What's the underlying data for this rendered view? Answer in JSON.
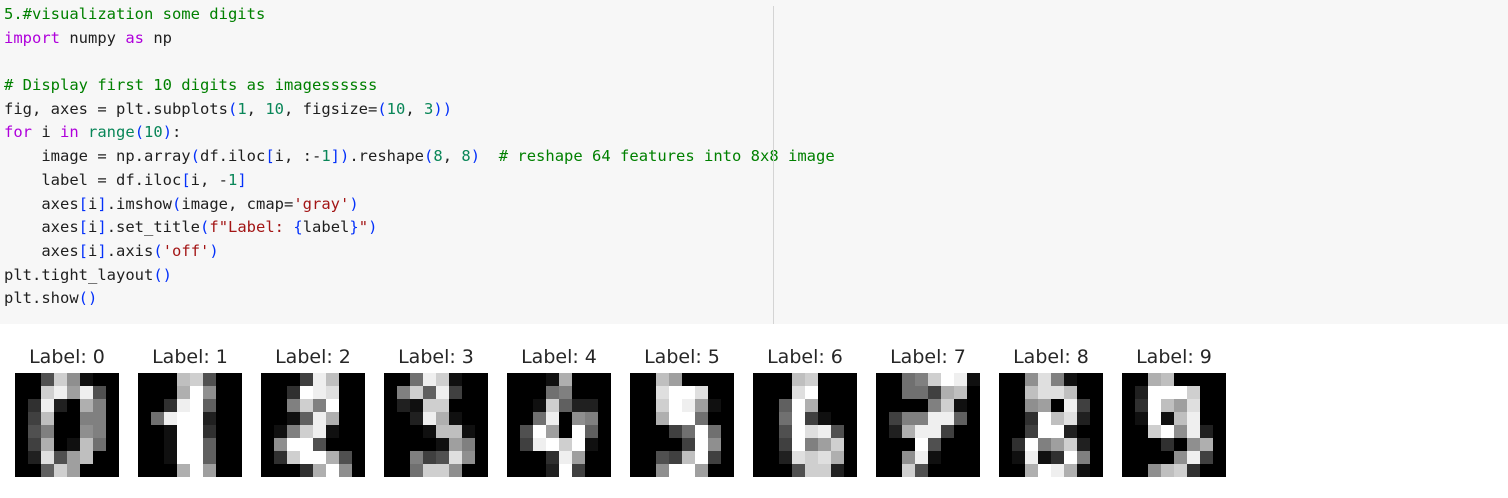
{
  "code_cell": {
    "lines": [
      [
        {
          "t": "5.#visualization some digits",
          "c": "comment"
        }
      ],
      [
        {
          "t": "import",
          "c": "keyword"
        },
        {
          "t": " numpy ",
          "c": "default"
        },
        {
          "t": "as",
          "c": "keyword"
        },
        {
          "t": " np",
          "c": "default"
        }
      ],
      [],
      [
        {
          "t": "# Display first 10 digits as imagessssss",
          "c": "comment"
        }
      ],
      [
        {
          "t": "fig, axes = plt.subplots",
          "c": "default"
        },
        {
          "t": "(",
          "c": "bracket"
        },
        {
          "t": "1",
          "c": "number"
        },
        {
          "t": ", ",
          "c": "default"
        },
        {
          "t": "10",
          "c": "number"
        },
        {
          "t": ", figsize=",
          "c": "default"
        },
        {
          "t": "(",
          "c": "bracket"
        },
        {
          "t": "10",
          "c": "number"
        },
        {
          "t": ", ",
          "c": "default"
        },
        {
          "t": "3",
          "c": "number"
        },
        {
          "t": "))",
          "c": "bracket"
        }
      ],
      [
        {
          "t": "for",
          "c": "keyword"
        },
        {
          "t": " i ",
          "c": "default"
        },
        {
          "t": "in",
          "c": "keyword"
        },
        {
          "t": " ",
          "c": "default"
        },
        {
          "t": "range",
          "c": "number"
        },
        {
          "t": "(",
          "c": "bracket"
        },
        {
          "t": "10",
          "c": "number"
        },
        {
          "t": ")",
          "c": "bracket"
        },
        {
          "t": ":",
          "c": "default"
        }
      ],
      [
        {
          "t": "    image = np.array",
          "c": "default"
        },
        {
          "t": "(",
          "c": "bracket"
        },
        {
          "t": "df.iloc",
          "c": "default"
        },
        {
          "t": "[",
          "c": "bracket"
        },
        {
          "t": "i, :-",
          "c": "default"
        },
        {
          "t": "1",
          "c": "number"
        },
        {
          "t": "])",
          "c": "bracket"
        },
        {
          "t": ".reshape",
          "c": "default"
        },
        {
          "t": "(",
          "c": "bracket"
        },
        {
          "t": "8",
          "c": "number"
        },
        {
          "t": ", ",
          "c": "default"
        },
        {
          "t": "8",
          "c": "number"
        },
        {
          "t": ")",
          "c": "bracket"
        },
        {
          "t": "  ",
          "c": "default"
        },
        {
          "t": "# reshape 64 features into 8x8 image",
          "c": "comment"
        }
      ],
      [
        {
          "t": "    label = df.iloc",
          "c": "default"
        },
        {
          "t": "[",
          "c": "bracket"
        },
        {
          "t": "i, -",
          "c": "default"
        },
        {
          "t": "1",
          "c": "number"
        },
        {
          "t": "]",
          "c": "bracket"
        }
      ],
      [
        {
          "t": "    axes",
          "c": "default"
        },
        {
          "t": "[",
          "c": "bracket"
        },
        {
          "t": "i",
          "c": "default"
        },
        {
          "t": "]",
          "c": "bracket"
        },
        {
          "t": ".imshow",
          "c": "default"
        },
        {
          "t": "(",
          "c": "bracket"
        },
        {
          "t": "image, cmap=",
          "c": "default"
        },
        {
          "t": "'gray'",
          "c": "string"
        },
        {
          "t": ")",
          "c": "bracket"
        }
      ],
      [
        {
          "t": "    axes",
          "c": "default"
        },
        {
          "t": "[",
          "c": "bracket"
        },
        {
          "t": "i",
          "c": "default"
        },
        {
          "t": "]",
          "c": "bracket"
        },
        {
          "t": ".set_title",
          "c": "default"
        },
        {
          "t": "(",
          "c": "bracket"
        },
        {
          "t": "f\"Label: ",
          "c": "string"
        },
        {
          "t": "{",
          "c": "bracket"
        },
        {
          "t": "label",
          "c": "default"
        },
        {
          "t": "}",
          "c": "bracket"
        },
        {
          "t": "\"",
          "c": "string"
        },
        {
          "t": ")",
          "c": "bracket"
        }
      ],
      [
        {
          "t": "    axes",
          "c": "default"
        },
        {
          "t": "[",
          "c": "bracket"
        },
        {
          "t": "i",
          "c": "default"
        },
        {
          "t": "]",
          "c": "bracket"
        },
        {
          "t": ".axis",
          "c": "default"
        },
        {
          "t": "(",
          "c": "bracket"
        },
        {
          "t": "'off'",
          "c": "string"
        },
        {
          "t": ")",
          "c": "bracket"
        }
      ],
      [
        {
          "t": "plt.tight_layout",
          "c": "default"
        },
        {
          "t": "()",
          "c": "bracket"
        }
      ],
      [
        {
          "t": "plt.show",
          "c": "default"
        },
        {
          "t": "()",
          "c": "bracket"
        }
      ]
    ]
  },
  "output": {
    "colormap": "gray",
    "panels": [
      {
        "title": "Label: 0",
        "pixels": [
          [
            0,
            0,
            5,
            13,
            9,
            1,
            0,
            0
          ],
          [
            0,
            0,
            13,
            15,
            10,
            15,
            5,
            0
          ],
          [
            0,
            3,
            15,
            2,
            0,
            11,
            8,
            0
          ],
          [
            0,
            4,
            12,
            0,
            0,
            8,
            8,
            0
          ],
          [
            0,
            5,
            8,
            0,
            0,
            9,
            8,
            0
          ],
          [
            0,
            4,
            11,
            0,
            1,
            12,
            7,
            0
          ],
          [
            0,
            2,
            14,
            5,
            10,
            12,
            0,
            0
          ],
          [
            0,
            0,
            6,
            13,
            10,
            0,
            0,
            0
          ]
        ]
      },
      {
        "title": "Label: 1",
        "pixels": [
          [
            0,
            0,
            0,
            12,
            13,
            5,
            0,
            0
          ],
          [
            0,
            0,
            0,
            11,
            16,
            9,
            0,
            0
          ],
          [
            0,
            0,
            3,
            15,
            16,
            6,
            0,
            0
          ],
          [
            0,
            7,
            15,
            16,
            16,
            2,
            0,
            0
          ],
          [
            0,
            0,
            1,
            16,
            16,
            3,
            0,
            0
          ],
          [
            0,
            0,
            1,
            16,
            16,
            6,
            0,
            0
          ],
          [
            0,
            0,
            1,
            16,
            16,
            6,
            0,
            0
          ],
          [
            0,
            0,
            0,
            11,
            16,
            10,
            0,
            0
          ]
        ]
      },
      {
        "title": "Label: 2",
        "pixels": [
          [
            0,
            0,
            0,
            4,
            15,
            12,
            0,
            0
          ],
          [
            0,
            0,
            3,
            16,
            15,
            14,
            0,
            0
          ],
          [
            0,
            0,
            8,
            13,
            8,
            16,
            0,
            0
          ],
          [
            0,
            0,
            1,
            6,
            15,
            11,
            0,
            0
          ],
          [
            0,
            1,
            8,
            13,
            15,
            1,
            0,
            0
          ],
          [
            0,
            9,
            16,
            16,
            5,
            0,
            0,
            0
          ],
          [
            0,
            3,
            13,
            16,
            16,
            11,
            5,
            0
          ],
          [
            0,
            0,
            0,
            3,
            11,
            16,
            9,
            0
          ]
        ]
      },
      {
        "title": "Label: 3",
        "pixels": [
          [
            0,
            0,
            7,
            15,
            13,
            1,
            0,
            0
          ],
          [
            0,
            8,
            13,
            6,
            15,
            4,
            0,
            0
          ],
          [
            0,
            2,
            1,
            13,
            13,
            0,
            0,
            0
          ],
          [
            0,
            0,
            2,
            15,
            11,
            1,
            0,
            0
          ],
          [
            0,
            0,
            0,
            1,
            12,
            12,
            1,
            0
          ],
          [
            0,
            0,
            0,
            0,
            1,
            10,
            8,
            0
          ],
          [
            0,
            0,
            8,
            4,
            5,
            14,
            9,
            0
          ],
          [
            0,
            0,
            7,
            13,
            13,
            9,
            0,
            0
          ]
        ]
      },
      {
        "title": "Label: 4",
        "pixels": [
          [
            0,
            0,
            0,
            1,
            11,
            0,
            0,
            0
          ],
          [
            0,
            0,
            0,
            7,
            8,
            0,
            0,
            0
          ],
          [
            0,
            0,
            1,
            13,
            6,
            2,
            2,
            0
          ],
          [
            0,
            0,
            7,
            15,
            0,
            9,
            8,
            0
          ],
          [
            0,
            5,
            16,
            10,
            0,
            16,
            6,
            0
          ],
          [
            0,
            4,
            15,
            16,
            13,
            16,
            1,
            0
          ],
          [
            0,
            0,
            0,
            3,
            15,
            10,
            0,
            0
          ],
          [
            0,
            0,
            0,
            2,
            16,
            4,
            0,
            0
          ]
        ]
      },
      {
        "title": "Label: 5",
        "pixels": [
          [
            0,
            0,
            12,
            10,
            0,
            0,
            0,
            0
          ],
          [
            0,
            0,
            14,
            16,
            16,
            14,
            0,
            0
          ],
          [
            0,
            0,
            13,
            16,
            15,
            10,
            1,
            0
          ],
          [
            0,
            0,
            11,
            16,
            16,
            7,
            0,
            0
          ],
          [
            0,
            0,
            0,
            4,
            7,
            16,
            7,
            0
          ],
          [
            0,
            0,
            0,
            0,
            4,
            16,
            9,
            0
          ],
          [
            0,
            0,
            5,
            4,
            12,
            16,
            4,
            0
          ],
          [
            0,
            0,
            9,
            16,
            16,
            10,
            0,
            0
          ]
        ]
      },
      {
        "title": "Label: 6",
        "pixels": [
          [
            0,
            0,
            0,
            12,
            13,
            0,
            0,
            0
          ],
          [
            0,
            0,
            0,
            14,
            16,
            0,
            0,
            0
          ],
          [
            0,
            0,
            6,
            16,
            11,
            0,
            0,
            0
          ],
          [
            0,
            0,
            7,
            16,
            4,
            1,
            0,
            0
          ],
          [
            0,
            0,
            5,
            16,
            14,
            15,
            5,
            0
          ],
          [
            0,
            0,
            4,
            16,
            8,
            10,
            13,
            0
          ],
          [
            0,
            0,
            2,
            14,
            13,
            14,
            11,
            0
          ],
          [
            0,
            0,
            0,
            5,
            13,
            13,
            2,
            0
          ]
        ]
      },
      {
        "title": "Label: 7",
        "pixels": [
          [
            0,
            0,
            7,
            8,
            13,
            16,
            15,
            1
          ],
          [
            0,
            0,
            7,
            7,
            4,
            11,
            12,
            0
          ],
          [
            0,
            0,
            0,
            0,
            8,
            13,
            1,
            0
          ],
          [
            0,
            4,
            8,
            8,
            15,
            15,
            6,
            0
          ],
          [
            0,
            2,
            11,
            15,
            15,
            4,
            0,
            0
          ],
          [
            0,
            0,
            0,
            16,
            5,
            0,
            0,
            0
          ],
          [
            0,
            0,
            9,
            15,
            1,
            0,
            0,
            0
          ],
          [
            0,
            0,
            13,
            5,
            0,
            0,
            0,
            0
          ]
        ]
      },
      {
        "title": "Label: 8",
        "pixels": [
          [
            0,
            0,
            9,
            14,
            8,
            1,
            0,
            0
          ],
          [
            0,
            0,
            12,
            14,
            14,
            12,
            0,
            0
          ],
          [
            0,
            0,
            9,
            10,
            0,
            15,
            4,
            0
          ],
          [
            0,
            0,
            3,
            16,
            12,
            14,
            2,
            0
          ],
          [
            0,
            0,
            4,
            16,
            16,
            2,
            0,
            0
          ],
          [
            0,
            3,
            16,
            8,
            10,
            13,
            2,
            0
          ],
          [
            0,
            1,
            15,
            1,
            3,
            16,
            8,
            0
          ],
          [
            0,
            0,
            11,
            16,
            15,
            11,
            1,
            0
          ]
        ]
      },
      {
        "title": "Label: 9",
        "pixels": [
          [
            0,
            0,
            11,
            12,
            0,
            0,
            0,
            0
          ],
          [
            0,
            2,
            16,
            16,
            16,
            13,
            0,
            0
          ],
          [
            0,
            3,
            16,
            12,
            10,
            14,
            0,
            0
          ],
          [
            0,
            1,
            16,
            1,
            12,
            15,
            0,
            0
          ],
          [
            0,
            0,
            13,
            16,
            9,
            15,
            2,
            0
          ],
          [
            0,
            0,
            0,
            3,
            0,
            9,
            11,
            0
          ],
          [
            0,
            0,
            0,
            0,
            9,
            15,
            4,
            0
          ],
          [
            0,
            0,
            9,
            12,
            13,
            3,
            0,
            0
          ]
        ]
      }
    ]
  }
}
